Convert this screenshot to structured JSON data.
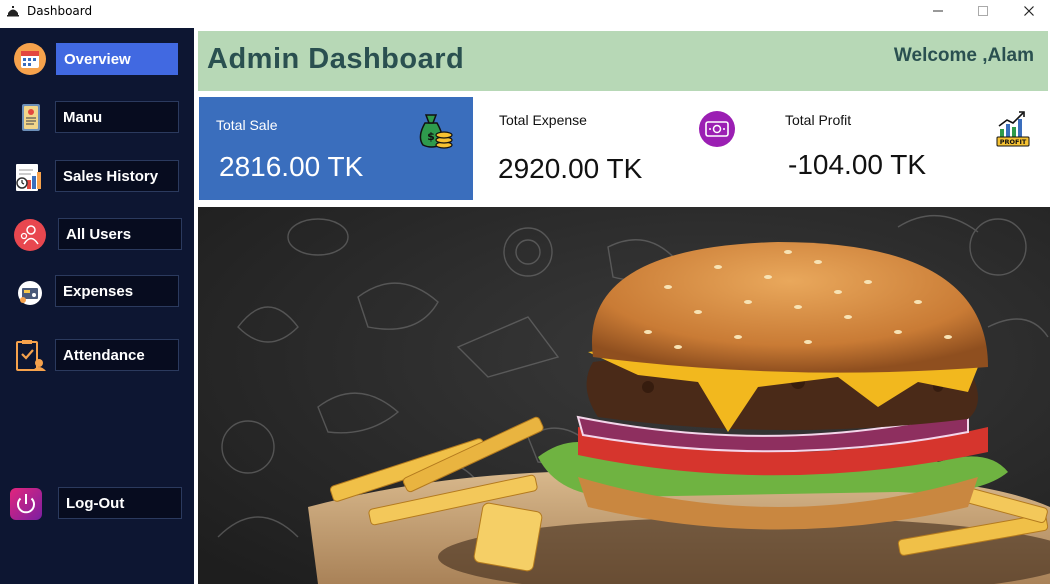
{
  "window": {
    "title": "Dashboard",
    "minimize": "—",
    "maximize": "☐",
    "close": "✕"
  },
  "sidebar": {
    "items": [
      {
        "label": "Overview",
        "icon": "calendar-report-icon",
        "active": true
      },
      {
        "label": "Manu",
        "icon": "menu-card-icon"
      },
      {
        "label": "Sales History",
        "icon": "sales-report-icon"
      },
      {
        "label": "All Users",
        "icon": "users-icon"
      },
      {
        "label": "Expenses",
        "icon": "expenses-icon"
      },
      {
        "label": "Attendance",
        "icon": "attendance-icon"
      }
    ],
    "logout": {
      "label": "Log-Out",
      "icon": "power-icon"
    }
  },
  "header": {
    "title": "Admin Dashboard",
    "welcome": "Welcome ,Alam"
  },
  "cards": {
    "sale": {
      "label": "Total Sale",
      "value": "2816.00  TK",
      "icon": "money-bag-icon"
    },
    "expense": {
      "label": "Total Expense",
      "value": "2920.00  TK",
      "icon": "cash-icon"
    },
    "profit": {
      "label": "Total Profit",
      "value": "-104.00  TK",
      "icon": "profit-chart-icon",
      "badge": "PROFIT"
    }
  },
  "banner": {
    "image": "burger-and-fries-photo"
  },
  "colors": {
    "sidebar_bg": "#0d1632",
    "active_accent": "#4169e1",
    "header_bg": "#b7d8b6",
    "header_text": "#2a5050",
    "sale_card": "#3a6ebd"
  }
}
